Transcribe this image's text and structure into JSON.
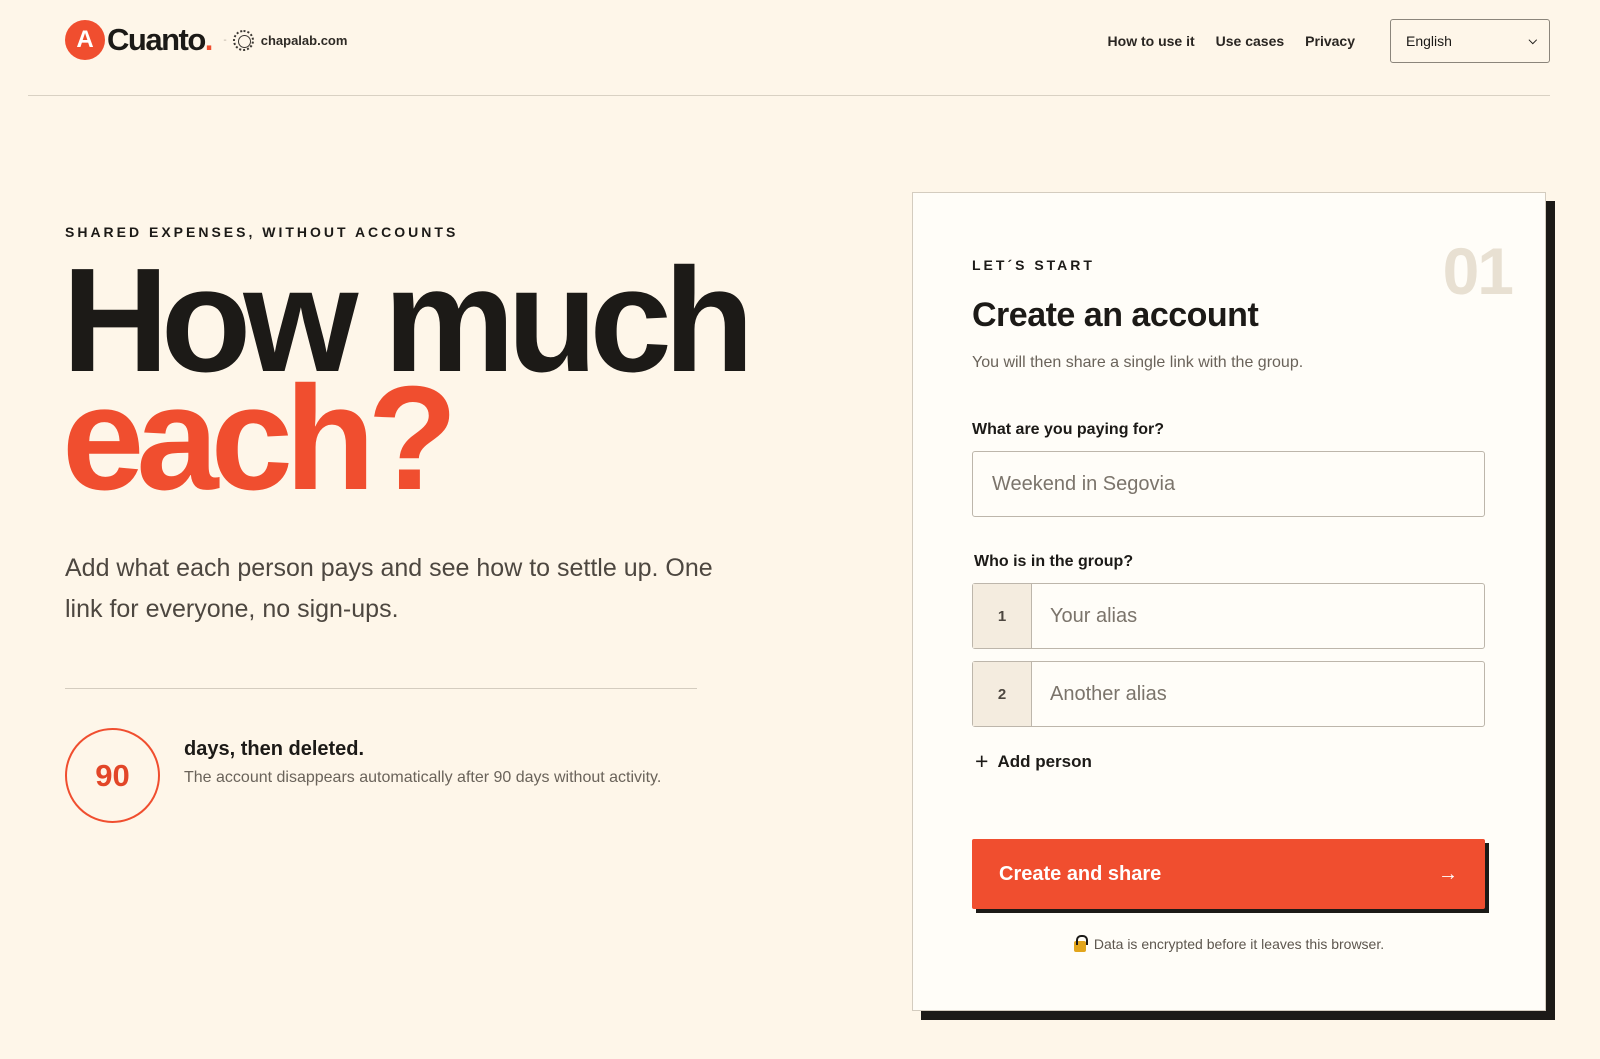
{
  "header": {
    "brand": "Cuanto",
    "brand_dot": ".",
    "logo_letter": "A",
    "separator": "-",
    "lab_name": "chapalab.com",
    "nav": [
      {
        "label": "How to use it"
      },
      {
        "label": "Use cases"
      },
      {
        "label": "Privacy"
      }
    ],
    "language": {
      "selected": "English"
    }
  },
  "hero": {
    "eyebrow": "SHARED EXPENSES, WITHOUT ACCOUNTS",
    "title_line1": "How much",
    "title_line2": "each?",
    "lead": "Add what each person pays and see how to settle up. One link for everyone, no sign-ups.",
    "retention": {
      "days": "90",
      "title": "days, then deleted.",
      "description": "The account disappears automatically after 90 days without activity."
    }
  },
  "card": {
    "step": "01",
    "eyebrow": "LET´S START",
    "title": "Create an account",
    "subtitle": "You will then share a single link with the group.",
    "paying_for_label": "What are you paying for?",
    "paying_for_placeholder": "Weekend in Segovia",
    "group_label": "Who is in the group?",
    "people": [
      {
        "number": "1",
        "placeholder": "Your alias"
      },
      {
        "number": "2",
        "placeholder": "Another alias"
      }
    ],
    "add_person": "Add person",
    "add_person_symbol": "+",
    "cta": "Create and share",
    "cta_arrow": "→",
    "note": "Data is encrypted before it leaves this browser."
  },
  "colors": {
    "background": "#fef6e9",
    "accent": "#f04e2f",
    "ink": "#1c1a17"
  },
  "icons": [
    "lab-logo-icon",
    "chevron-down-icon",
    "plus-icon",
    "arrow-right-icon",
    "lock-icon"
  ]
}
